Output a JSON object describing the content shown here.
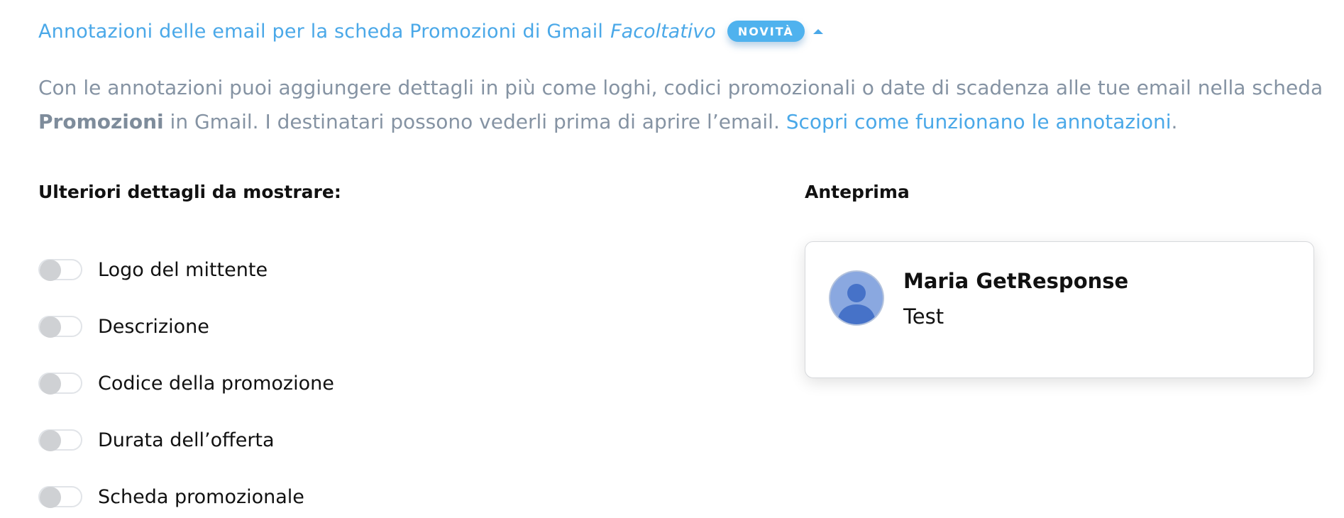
{
  "section": {
    "title": "Annotazioni delle email per la scheda Promozioni di Gmail",
    "optional_label": "Facoltativo",
    "badge": "NOVITÀ",
    "accent_color": "#4aa8e8"
  },
  "description": {
    "line1": "Con le annotazioni puoi aggiungere dettagli in più come loghi, codici promozionali o date di scadenza alle tue email nella scheda",
    "line2_bold": "Promozioni",
    "line2_text": " in Gmail. I destinatari possono vederli prima di aprire l’email. ",
    "link": "Scopri come funzionano le annotazioni",
    "line2_end": "."
  },
  "details": {
    "heading": "Ulteriori dettagli da mostrare:",
    "toggles": [
      {
        "label": "Logo del mittente",
        "checked": false
      },
      {
        "label": "Descrizione",
        "checked": false
      },
      {
        "label": "Codice della promozione",
        "checked": false
      },
      {
        "label": "Durata dell’offerta",
        "checked": false
      },
      {
        "label": "Scheda promozionale",
        "checked": false
      }
    ]
  },
  "preview": {
    "heading": "Anteprima",
    "sender": "Maria GetResponse",
    "subject": "Test",
    "avatar_icon": "user-avatar-icon"
  }
}
